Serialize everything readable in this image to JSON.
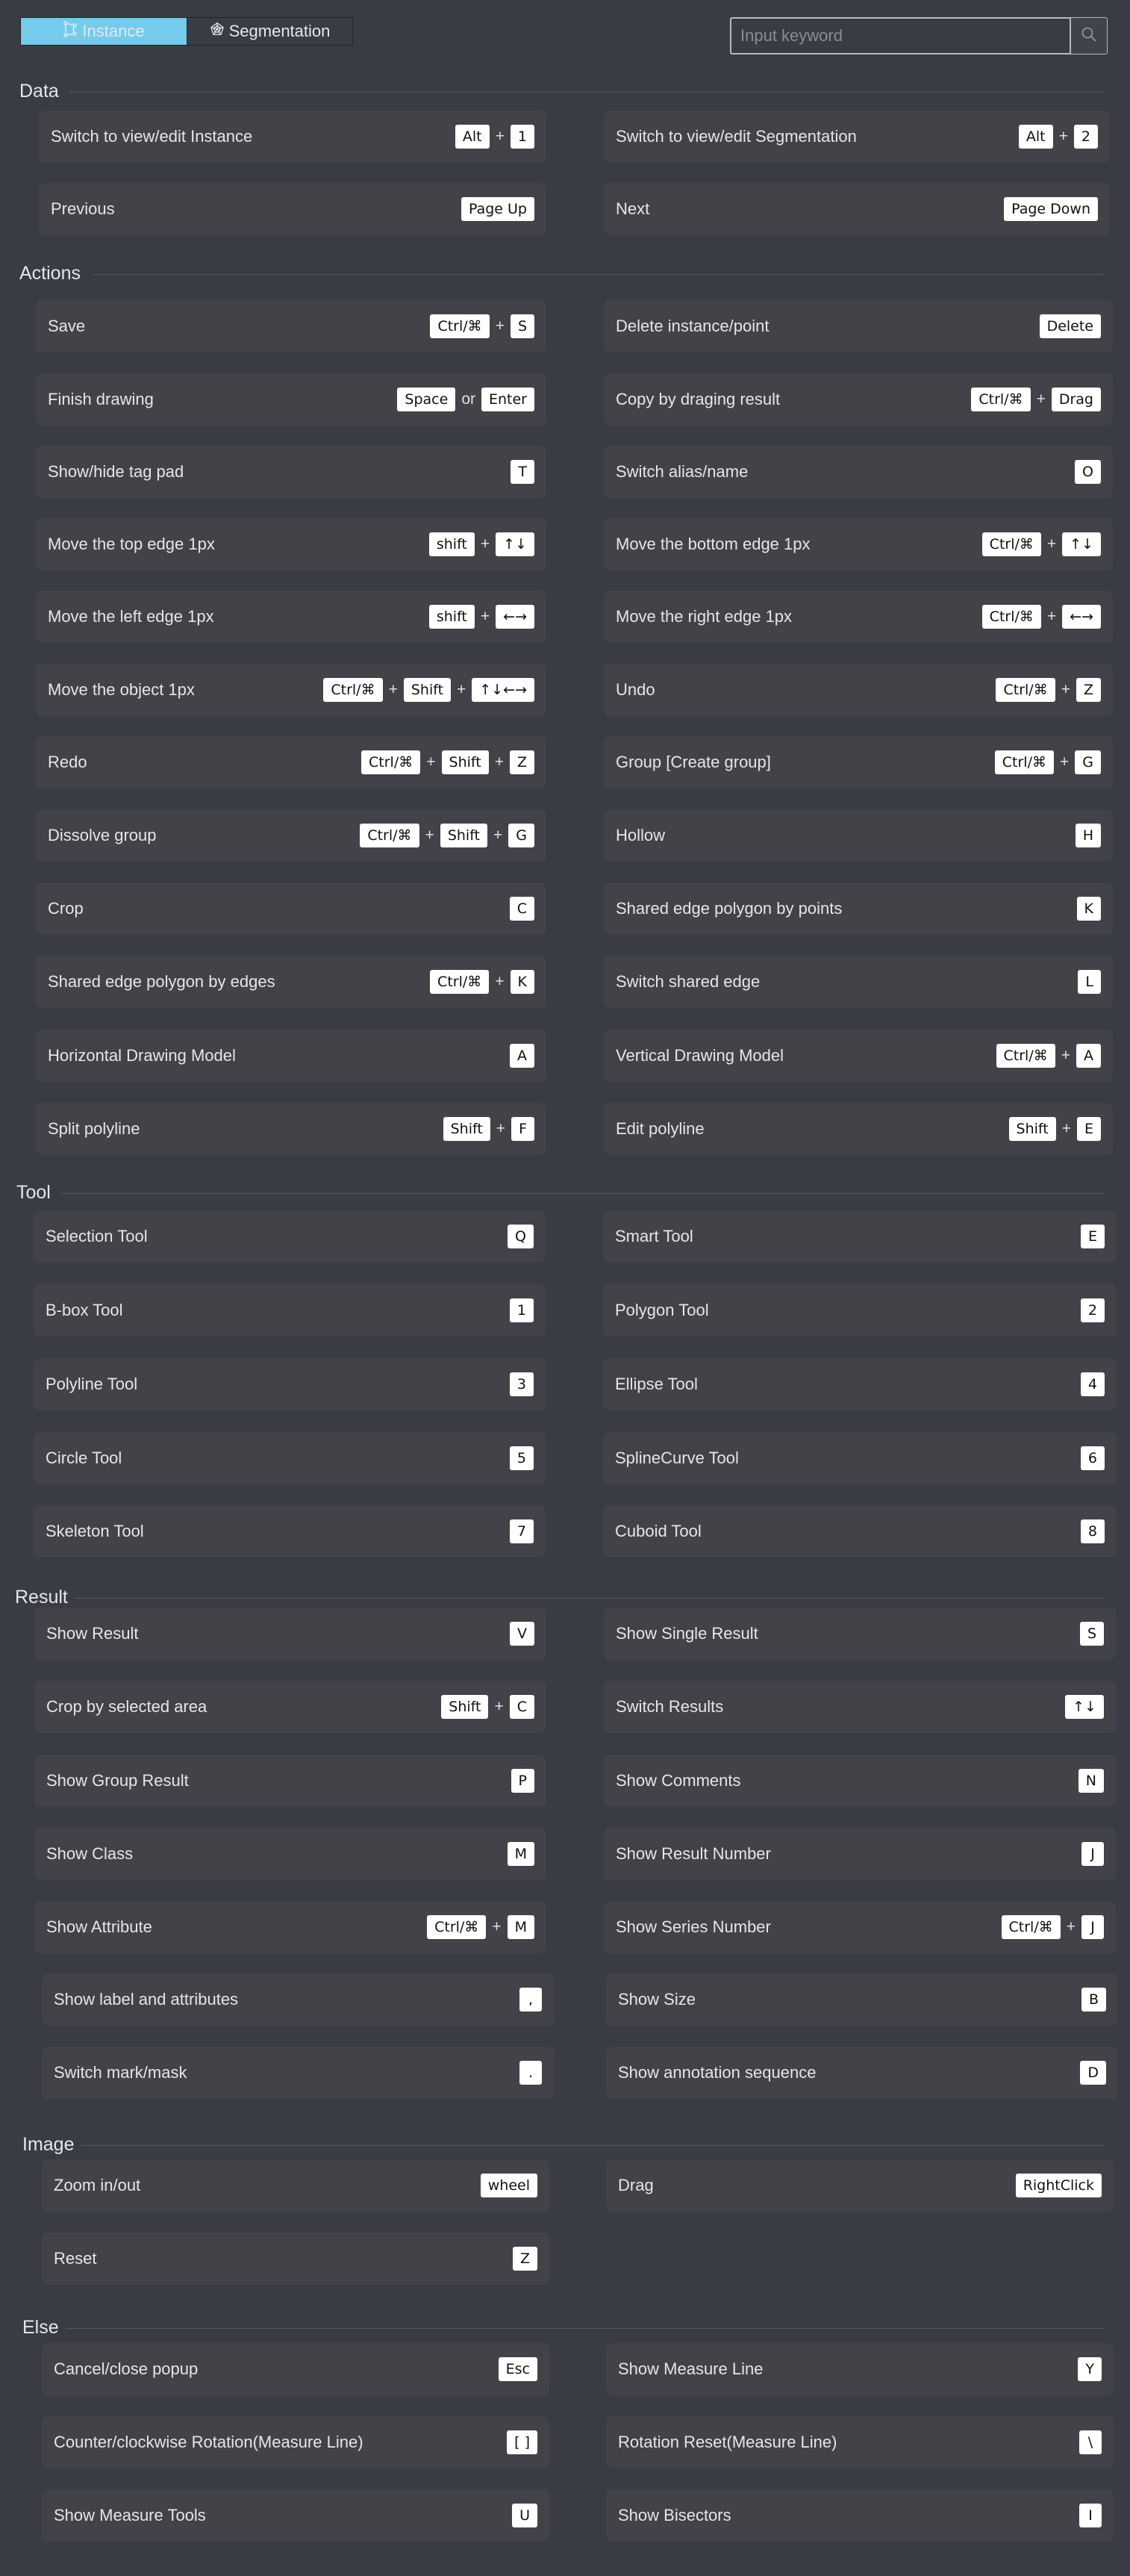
{
  "tabs": [
    {
      "label": "Instance",
      "icon": "polygon-instance-icon",
      "active": true
    },
    {
      "label": "Segmentation",
      "icon": "pentagon-web-icon",
      "active": false
    }
  ],
  "search": {
    "placeholder": "Input keyword",
    "value": "",
    "icon": "search-icon"
  },
  "colors": {
    "background": "#393c44",
    "row": "#434248",
    "accent": "#75cbec",
    "key_bg": "#ffffff"
  },
  "sections": [
    {
      "title": "Data",
      "rows": [
        {
          "left": {
            "label": "Switch to view/edit Instance",
            "keys": [
              "Alt",
              "+",
              "1"
            ]
          },
          "right": {
            "label": "Switch to view/edit Segmentation",
            "keys": [
              "Alt",
              "+",
              "2"
            ]
          }
        },
        {
          "left": {
            "label": "Previous",
            "keys": [
              "Page Up"
            ]
          },
          "right": {
            "label": "Next",
            "keys": [
              "Page Down"
            ]
          }
        }
      ]
    },
    {
      "title": "Actions",
      "rows": [
        {
          "left": {
            "label": "Save",
            "keys": [
              "Ctrl/⌘",
              "+",
              "S"
            ]
          },
          "right": {
            "label": "Delete instance/point",
            "keys": [
              "Delete"
            ]
          }
        },
        {
          "left": {
            "label": "Finish drawing",
            "keys": [
              "Space",
              "or",
              "Enter"
            ]
          },
          "right": {
            "label": "Copy by draging result",
            "keys": [
              "Ctrl/⌘",
              "+",
              "Drag"
            ]
          }
        },
        {
          "left": {
            "label": "Show/hide tag pad",
            "keys": [
              "T"
            ]
          },
          "right": {
            "label": "Switch alias/name",
            "keys": [
              "O"
            ]
          }
        },
        {
          "left": {
            "label": "Move the top edge 1px",
            "keys": [
              "shift",
              "+",
              "↑↓"
            ]
          },
          "right": {
            "label": "Move the bottom edge 1px",
            "keys": [
              "Ctrl/⌘",
              "+",
              "↑↓"
            ]
          }
        },
        {
          "left": {
            "label": "Move the left edge 1px",
            "keys": [
              "shift",
              "+",
              "←→"
            ]
          },
          "right": {
            "label": "Move the right edge 1px",
            "keys": [
              "Ctrl/⌘",
              "+",
              "←→"
            ]
          }
        },
        {
          "left": {
            "label": "Move the object 1px",
            "keys": [
              "Ctrl/⌘",
              "+",
              "Shift",
              "+",
              "↑↓←→"
            ]
          },
          "right": {
            "label": "Undo",
            "keys": [
              "Ctrl/⌘",
              "+",
              "Z"
            ]
          }
        },
        {
          "left": {
            "label": "Redo",
            "keys": [
              "Ctrl/⌘",
              "+",
              "Shift",
              "+",
              "Z"
            ]
          },
          "right": {
            "label": "Group [Create group]",
            "keys": [
              "Ctrl/⌘",
              "+",
              "G"
            ]
          }
        },
        {
          "left": {
            "label": "Dissolve group",
            "keys": [
              "Ctrl/⌘",
              "+",
              "Shift",
              "+",
              "G"
            ]
          },
          "right": {
            "label": "Hollow",
            "keys": [
              "H"
            ]
          }
        },
        {
          "left": {
            "label": "Crop",
            "keys": [
              "C"
            ]
          },
          "right": {
            "label": "Shared edge polygon by points",
            "keys": [
              "K"
            ]
          }
        },
        {
          "left": {
            "label": "Shared edge polygon by edges",
            "keys": [
              "Ctrl/⌘",
              "+",
              "K"
            ]
          },
          "right": {
            "label": "Switch shared edge",
            "keys": [
              "L"
            ]
          }
        },
        {
          "left": {
            "label": "Horizontal Drawing Model",
            "keys": [
              "A"
            ]
          },
          "right": {
            "label": "Vertical Drawing Model",
            "keys": [
              "Ctrl/⌘",
              "+",
              "A"
            ]
          }
        },
        {
          "left": {
            "label": "Split polyline",
            "keys": [
              "Shift",
              "+",
              "F"
            ]
          },
          "right": {
            "label": "Edit polyline",
            "keys": [
              "Shift",
              "+",
              "E"
            ]
          }
        }
      ]
    },
    {
      "title": "Tool",
      "rows": [
        {
          "left": {
            "label": "Selection Tool",
            "keys": [
              "Q"
            ]
          },
          "right": {
            "label": "Smart Tool",
            "keys": [
              "E"
            ]
          }
        },
        {
          "left": {
            "label": "B-box Tool",
            "keys": [
              "1"
            ]
          },
          "right": {
            "label": "Polygon Tool",
            "keys": [
              "2"
            ]
          }
        },
        {
          "left": {
            "label": "Polyline Tool",
            "keys": [
              "3"
            ]
          },
          "right": {
            "label": "Ellipse Tool",
            "keys": [
              "4"
            ]
          }
        },
        {
          "left": {
            "label": "Circle Tool",
            "keys": [
              "5"
            ]
          },
          "right": {
            "label": "SplineCurve Tool",
            "keys": [
              "6"
            ]
          }
        },
        {
          "left": {
            "label": "Skeleton Tool",
            "keys": [
              "7"
            ]
          },
          "right": {
            "label": "Cuboid Tool",
            "keys": [
              "8"
            ]
          }
        }
      ]
    },
    {
      "title": "Result",
      "rows": [
        {
          "left": {
            "label": "Show Result",
            "keys": [
              "V"
            ]
          },
          "right": {
            "label": "Show Single Result",
            "keys": [
              "S"
            ]
          }
        },
        {
          "left": {
            "label": "Crop by selected area",
            "keys": [
              "Shift",
              "+",
              "C"
            ]
          },
          "right": {
            "label": "Switch Results",
            "keys": [
              "↑↓"
            ]
          }
        },
        {
          "left": {
            "label": "Show Group Result",
            "keys": [
              "P"
            ]
          },
          "right": {
            "label": "Show Comments",
            "keys": [
              "N"
            ]
          }
        },
        {
          "left": {
            "label": "Show Class",
            "keys": [
              "M"
            ]
          },
          "right": {
            "label": "Show Result Number",
            "keys": [
              "J"
            ]
          }
        },
        {
          "left": {
            "label": "Show Attribute",
            "keys": [
              "Ctrl/⌘",
              "+",
              "M"
            ]
          },
          "right": {
            "label": "Show Series Number",
            "keys": [
              "Ctrl/⌘",
              "+",
              "J"
            ]
          }
        },
        {
          "left": {
            "label": "Show label and attributes",
            "keys": [
              ","
            ]
          },
          "right": {
            "label": "Show Size",
            "keys": [
              "B"
            ]
          }
        },
        {
          "left": {
            "label": "Switch mark/mask",
            "keys": [
              "."
            ]
          },
          "right": {
            "label": "Show annotation sequence",
            "keys": [
              "D"
            ]
          }
        }
      ]
    },
    {
      "title": "Image",
      "rows": [
        {
          "left": {
            "label": "Zoom in/out",
            "keys": [
              "wheel"
            ]
          },
          "right": {
            "label": "Drag",
            "keys": [
              "RightClick"
            ]
          }
        },
        {
          "left": {
            "label": "Reset",
            "keys": [
              "Z"
            ]
          },
          "right": null
        }
      ]
    },
    {
      "title": "Else",
      "rows": [
        {
          "left": {
            "label": "Cancel/close popup",
            "keys": [
              "Esc"
            ]
          },
          "right": {
            "label": "Show Measure Line",
            "keys": [
              "Y"
            ]
          }
        },
        {
          "left": {
            "label": "Counter/clockwise Rotation(Measure Line)",
            "keys": [
              "[ ]"
            ]
          },
          "right": {
            "label": "Rotation Reset(Measure Line)",
            "keys": [
              "\\"
            ]
          }
        },
        {
          "left": {
            "label": "Show Measure Tools",
            "keys": [
              "U"
            ]
          },
          "right": {
            "label": "Show Bisectors",
            "keys": [
              "I"
            ]
          }
        }
      ]
    }
  ]
}
